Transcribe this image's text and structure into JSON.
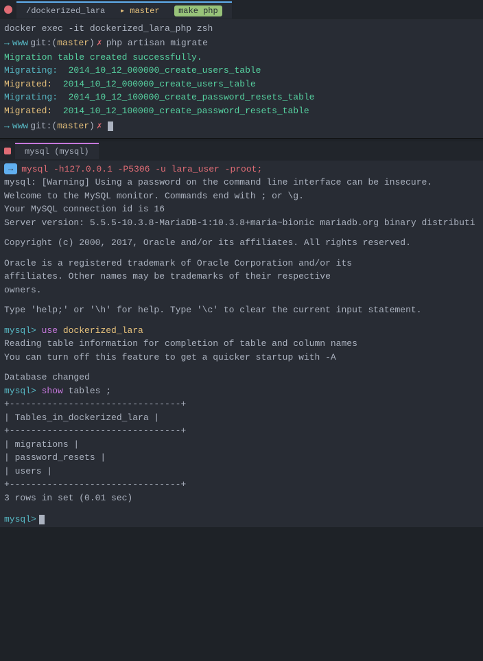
{
  "top_terminal": {
    "tab_title": "/dockerized_lara",
    "branch": "master",
    "cmd": "make php",
    "lines": [
      {
        "type": "docker-cmd",
        "text": "docker exec -it dockerized_lara_php zsh"
      },
      {
        "type": "sub-prompt",
        "text": "php artisan migrate"
      },
      {
        "type": "success",
        "text": "Migration table created successfully."
      },
      {
        "type": "migrating",
        "label": "Migrating:",
        "name": "2014_10_12_000000_create_users_table"
      },
      {
        "type": "migrated",
        "label": "Migrated: ",
        "name": "2014_10_12_000000_create_users_table"
      },
      {
        "type": "migrating",
        "label": "Migrating:",
        "name": "2014_10_12_100000_create_password_resets_table"
      },
      {
        "type": "migrated",
        "label": "Migrated: ",
        "name": "2014_10_12_100000_create_password_resets_table"
      }
    ]
  },
  "bottom_terminal": {
    "tab_title": "mysql (mysql)",
    "mysql_cmd": "mysql -h127.0.0.1 -P5306 -u lara_user -proot;",
    "warning": "mysql: [Warning] Using a password on the command line interface can be insecure.",
    "lines": [
      "Welcome to the MySQL monitor.  Commands end with ; or \\g.",
      "Your MySQL connection id is 16",
      "Server version: 5.5.5-10.3.8-MariaDB-1:10.3.8+maria~bionic mariadb.org binary distributi"
    ],
    "blank1": "",
    "copyright": "Copyright (c) 2000, 2017, Oracle and/or its affiliates. All rights reserved.",
    "blank2": "",
    "oracle_lines": [
      "Oracle is a registered trademark of Oracle Corporation and/or its",
      "affiliates. Other names may be trademarks of their respective",
      "owners."
    ],
    "blank3": "",
    "help_line": "Type 'help;' or '\\h' for help. Type '\\c' to clear the current input statement.",
    "blank4": "",
    "use_cmd": "mysql> use dockerized_lara",
    "reading_lines": [
      "Reading table information for completion of table and column names",
      "You can turn off this feature to get a quicker startup with -A"
    ],
    "blank5": "",
    "db_changed": "Database changed",
    "show_cmd": "mysql> show tables ;",
    "table_border": "+--------------------------------+",
    "table_header": "| Tables_in_dockerized_lara      |",
    "table_rows": [
      "| migrations                     |",
      "| password_resets                |",
      "| users                          |"
    ],
    "result_line": "3 rows in set (0.01 sec)",
    "blank6": ""
  }
}
